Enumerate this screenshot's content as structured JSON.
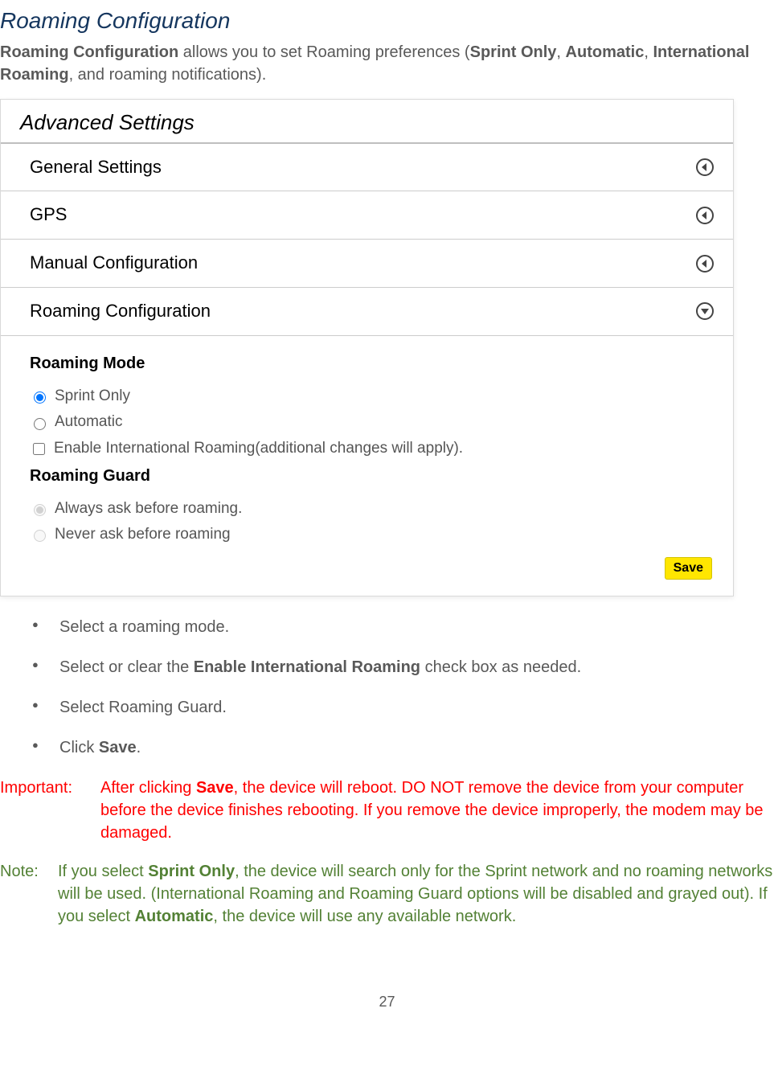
{
  "heading": "Roaming Configuration",
  "intro": {
    "strong1": "Roaming Configuration",
    "t1": " allows you to set Roaming preferences (",
    "strong2": "Sprint Only",
    "t2": ", ",
    "strong3": "Automatic",
    "t3": ", ",
    "strong4": "International Roaming",
    "t4": ", and roaming notifications)."
  },
  "panel": {
    "title": "Advanced Settings",
    "rows": {
      "general": "General Settings",
      "gps": "GPS",
      "manual": "Manual Configuration",
      "roaming": "Roaming Configuration"
    },
    "roaming_mode_h": "Roaming Mode",
    "opt_sprint": "Sprint Only",
    "opt_auto": "Automatic",
    "opt_intl": "Enable International Roaming(additional changes will apply).",
    "roaming_guard_h": "Roaming Guard",
    "guard_always": "Always ask before roaming.",
    "guard_never": "Never ask before roaming",
    "save": "Save"
  },
  "bullets": {
    "b1": "Select a roaming mode.",
    "b2_pre": "Select or clear the ",
    "b2_strong": "Enable International Roaming",
    "b2_post": " check box as needed.",
    "b3": "Select Roaming Guard.",
    "b4_pre": "Click ",
    "b4_strong": "Save",
    "b4_post": "."
  },
  "important": {
    "label": "Important:",
    "pre": "After clicking ",
    "strong": "Save",
    "post": ", the device will reboot. DO NOT remove the device from your computer before the device finishes rebooting. If you remove the device improperly, the modem may be damaged."
  },
  "note": {
    "label": "Note:",
    "t1": "If you select ",
    "s1": "Sprint Only",
    "t2": ", the device will search only for the Sprint network and no roaming networks will be used. (International Roaming and Roaming Guard options will be disabled and grayed out).  If you select ",
    "s2": "Automatic",
    "t3": ", the device will use any available network."
  },
  "page_number": "27"
}
